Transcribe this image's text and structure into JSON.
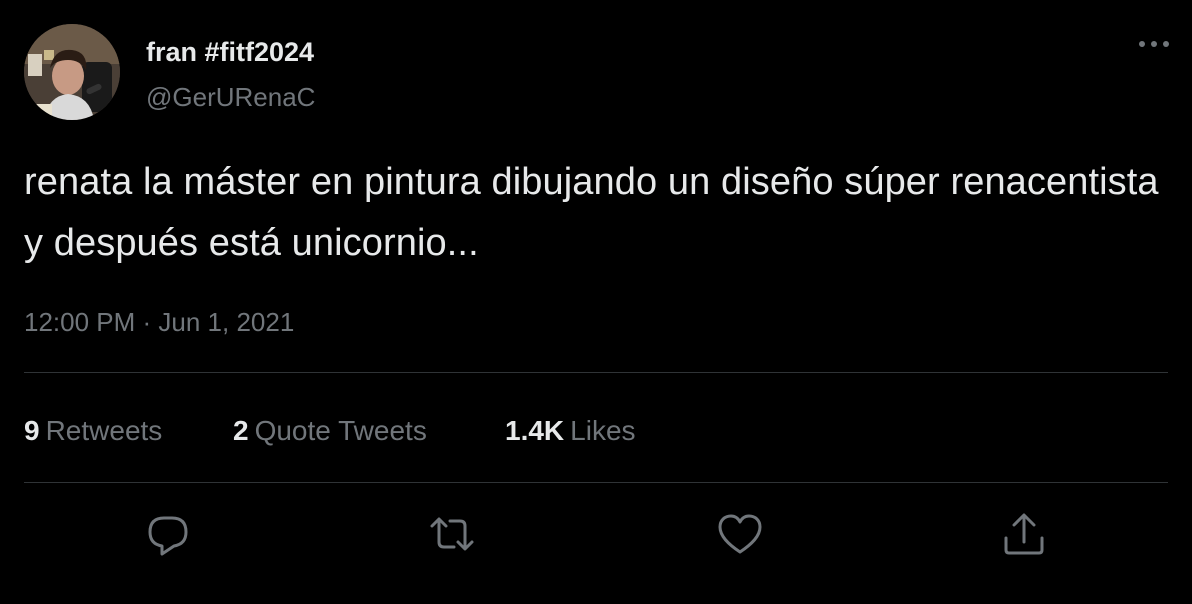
{
  "author": {
    "display_name": "fran #fitf2024",
    "handle": "@GerURenaC"
  },
  "tweet": {
    "text": "renata la máster en pintura dibujando un diseño súper renacentista y después está unicornio...",
    "timestamp": "12:00 PM · Jun 1, 2021"
  },
  "stats": {
    "retweets": {
      "count": "9",
      "label": "Retweets"
    },
    "quote_tweets": {
      "count": "2",
      "label": "Quote Tweets"
    },
    "likes": {
      "count": "1.4K",
      "label": "Likes"
    }
  },
  "actions": [
    "reply-icon",
    "retweet-icon",
    "like-icon",
    "share-icon"
  ],
  "colors": {
    "background": "#000000",
    "primary_text": "#e7e9ea",
    "secondary_text": "#71767b",
    "divider": "#2f3336"
  }
}
